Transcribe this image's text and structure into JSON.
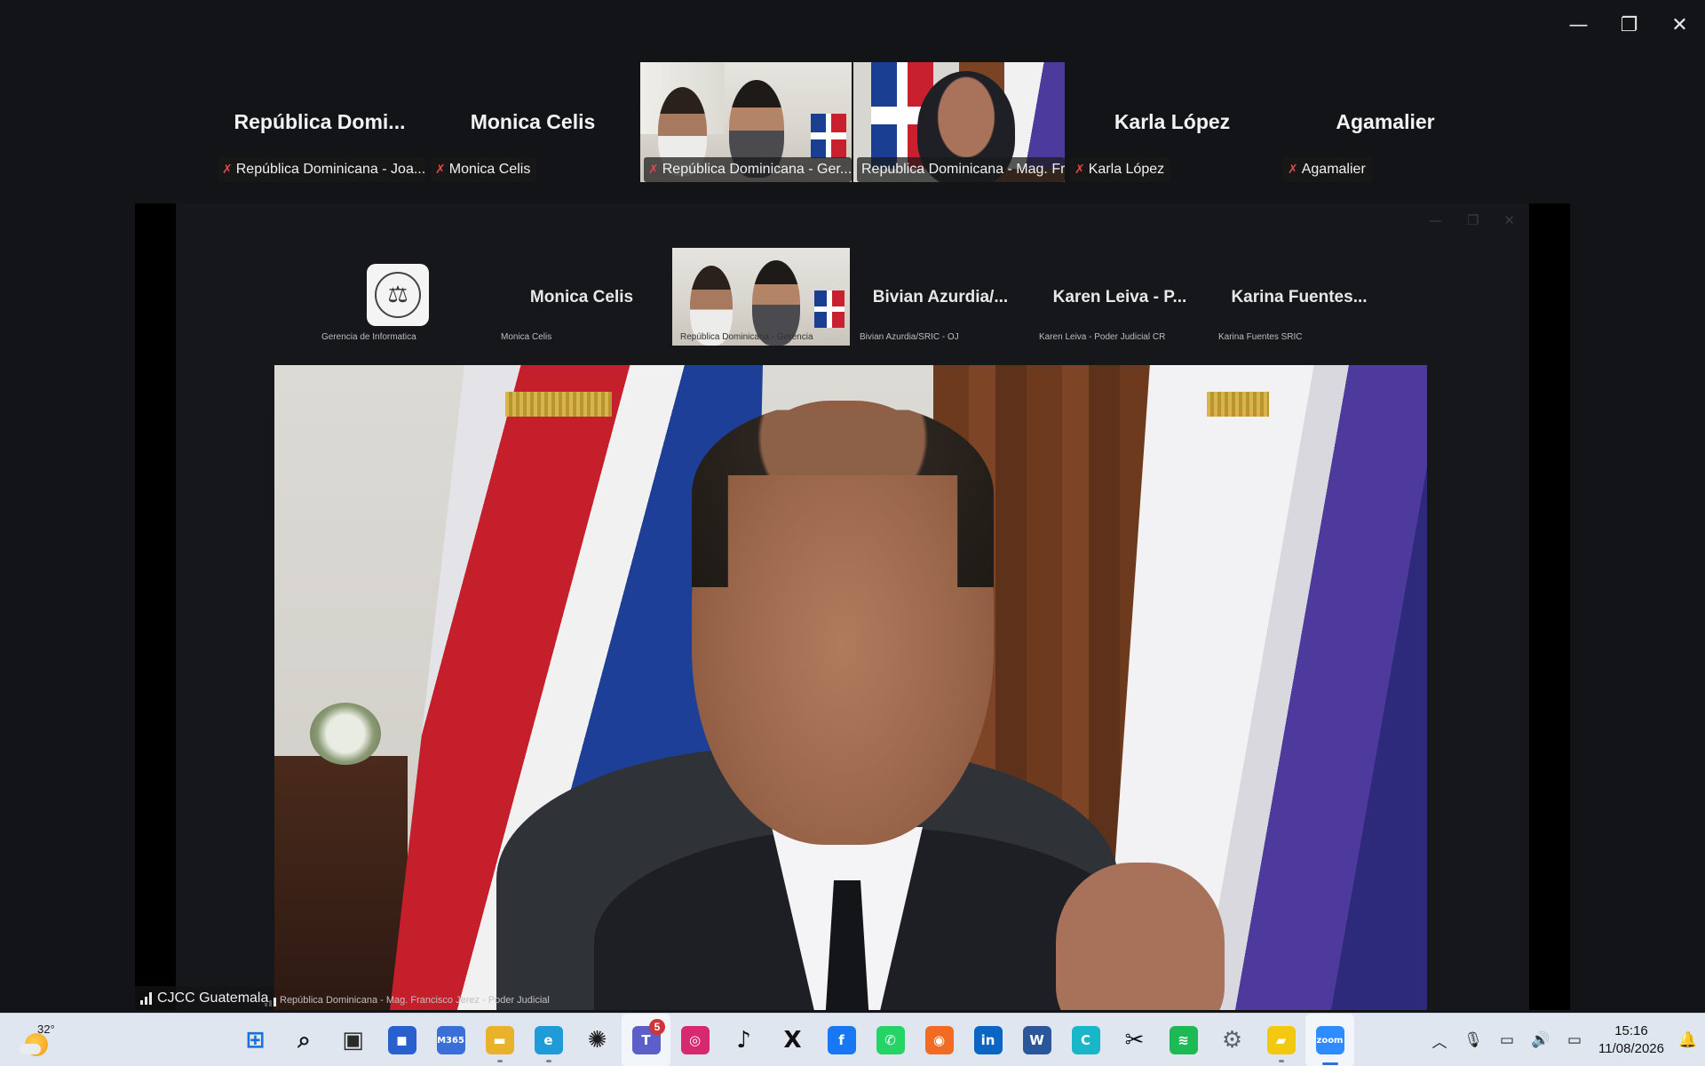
{
  "window": {
    "minimize_glyph": "—",
    "restore_glyph": "❐",
    "close_glyph": "✕"
  },
  "gallery": [
    {
      "name": "República  Domi...",
      "label": "República Dominicana - Joa...",
      "video": false
    },
    {
      "name": "Monica Celis",
      "label": "Monica Celis",
      "video": false
    },
    {
      "name": "",
      "label": "República Dominicana - Ger...",
      "video": true
    },
    {
      "name": "",
      "label": "Republica Dominicana - Mag. Fr...",
      "video": true
    },
    {
      "name": "Karla López",
      "label": "Karla López",
      "video": false
    },
    {
      "name": "Agamalier",
      "label": "Agamalier",
      "video": false
    }
  ],
  "shared_screen": {
    "gallery": [
      {
        "name": "",
        "label": "Gerencia de Informatica"
      },
      {
        "name": "Monica Celis",
        "label": "Monica Celis"
      },
      {
        "name": "",
        "label": "República Dominicana - Gerencia"
      },
      {
        "name": "Bivian  Azurdia/...",
        "label": "Bivian Azurdia/SRIC - OJ"
      },
      {
        "name": "Karen Leiva - P...",
        "label": "Karen Leiva - Poder Judicial CR"
      },
      {
        "name": "Karina  Fuentes...",
        "label": "Karina Fuentes SRIC"
      }
    ],
    "speaker_label": "República Dominicana - Mag. Francisco Jerez - Poder Judicial"
  },
  "active_speaker": "CJCC Guatemala",
  "taskbar": {
    "weather_temp": "32°",
    "apps": [
      {
        "name": "start-icon",
        "glyph": "⊞",
        "color": "#1a6fd9"
      },
      {
        "name": "search-icon",
        "glyph": "⌕",
        "color": "#1b1b1b"
      },
      {
        "name": "task-view-icon",
        "glyph": "▣",
        "color": "#2a2a2a"
      },
      {
        "name": "store-icon",
        "glyph": "◼",
        "color": "#2a5fd0"
      },
      {
        "name": "m365-icon",
        "glyph": "M365",
        "color": "#3a6fd9"
      },
      {
        "name": "file-explorer-icon",
        "glyph": "▬",
        "color": "#e8b22a"
      },
      {
        "name": "edge-icon",
        "glyph": "e",
        "color": "#1f9bd7"
      },
      {
        "name": "chatgpt-icon",
        "glyph": "✺",
        "color": "#1b1b1b"
      },
      {
        "name": "teams-icon",
        "glyph": "T",
        "color": "#5b5fc7",
        "badge": "5"
      },
      {
        "name": "instagram-icon",
        "glyph": "◎",
        "color": "#d6296f"
      },
      {
        "name": "tiktok-icon",
        "glyph": "♪",
        "color": "#111"
      },
      {
        "name": "x-icon",
        "glyph": "X",
        "color": "#111"
      },
      {
        "name": "facebook-icon",
        "glyph": "f",
        "color": "#1877f2"
      },
      {
        "name": "whatsapp-icon",
        "glyph": "✆",
        "color": "#25d366"
      },
      {
        "name": "firefox-icon",
        "glyph": "◉",
        "color": "#f26b22"
      },
      {
        "name": "linkedin-icon",
        "glyph": "in",
        "color": "#0a66c2"
      },
      {
        "name": "word-icon",
        "glyph": "W",
        "color": "#2b579a"
      },
      {
        "name": "canva-icon",
        "glyph": "C",
        "color": "#19b6c9"
      },
      {
        "name": "capcut-icon",
        "glyph": "✂",
        "color": "#111"
      },
      {
        "name": "spotify-icon",
        "glyph": "≋",
        "color": "#1db954"
      },
      {
        "name": "settings-icon",
        "glyph": "⚙",
        "color": "#5a6470"
      },
      {
        "name": "sticky-notes-icon",
        "glyph": "▰",
        "color": "#f2c811"
      },
      {
        "name": "zoom-icon",
        "glyph": "zoom",
        "color": "#2d8cff"
      }
    ],
    "tray": {
      "chevron_glyph": "︿",
      "mic_glyph": "🎙",
      "network_glyph": "▭",
      "volume_glyph": "🔊",
      "battery_glyph": "▭",
      "time": "15:16",
      "date": "11/08/2026",
      "notification_glyph": "🔔"
    }
  }
}
